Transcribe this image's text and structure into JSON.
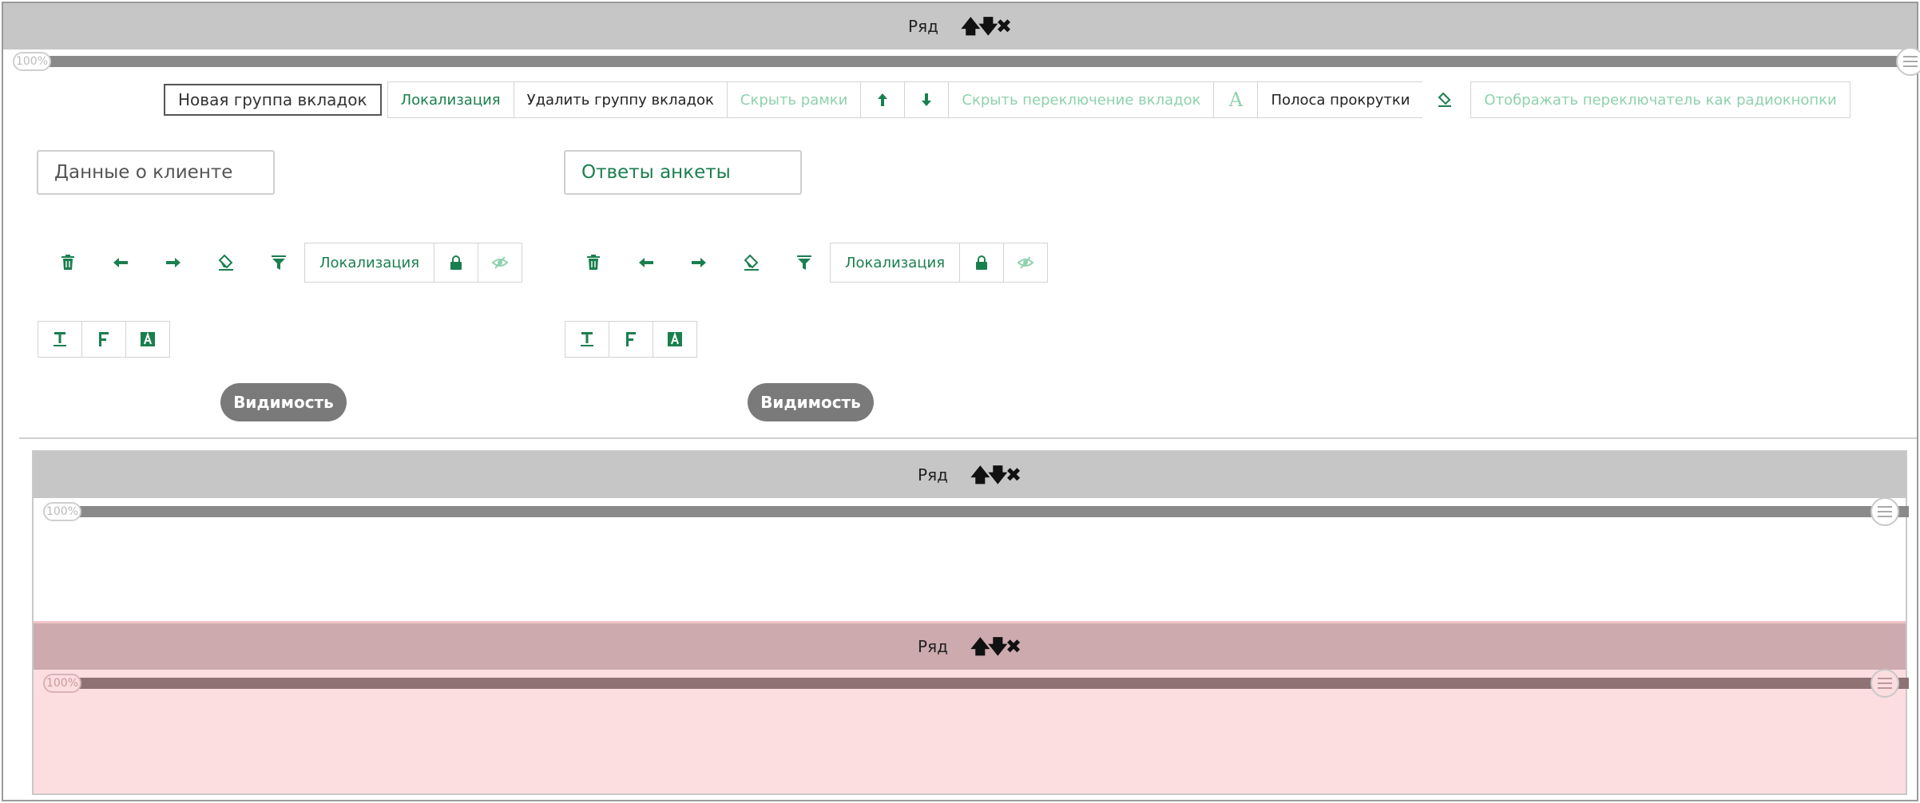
{
  "colors": {
    "accent": "#1a7f4e",
    "muted_accent": "#8fd1ae",
    "header_gray": "#c6c6c6",
    "pink_header": "#cdaaae",
    "pink_body": "#fcdde0"
  },
  "row": {
    "title": "Ряд",
    "arrows": [
      "🡅",
      "🡇",
      "✖"
    ],
    "percent": "100%",
    "handle_icon": "list-icon"
  },
  "tab_toolbar": {
    "new_group": "Новая группа вкладок",
    "localization": "Локализация",
    "delete_group": "Удалить группу вкладок",
    "hide_frames": "Скрыть рамки",
    "hide_tab_switch": "Скрыть переключение вкладок",
    "scrollbar": "Полоса прокрутки",
    "radio_switch": "Отображать переключатель как радиокнопки",
    "font_glyph": "A"
  },
  "tabs": [
    {
      "label": "Данные о клиенте",
      "localization": "Локализация",
      "visibility": "Видимость"
    },
    {
      "label": "Ответы анкеты",
      "localization": "Локализация",
      "visibility": "Видимость"
    }
  ],
  "format_icons": [
    "text-underline-icon",
    "font-F-icon",
    "font-color-icon"
  ],
  "nested_rows": [
    {
      "title": "Ряд",
      "percent": "100%"
    },
    {
      "title": "Ряд",
      "percent": "100%",
      "highlighted": true
    }
  ]
}
